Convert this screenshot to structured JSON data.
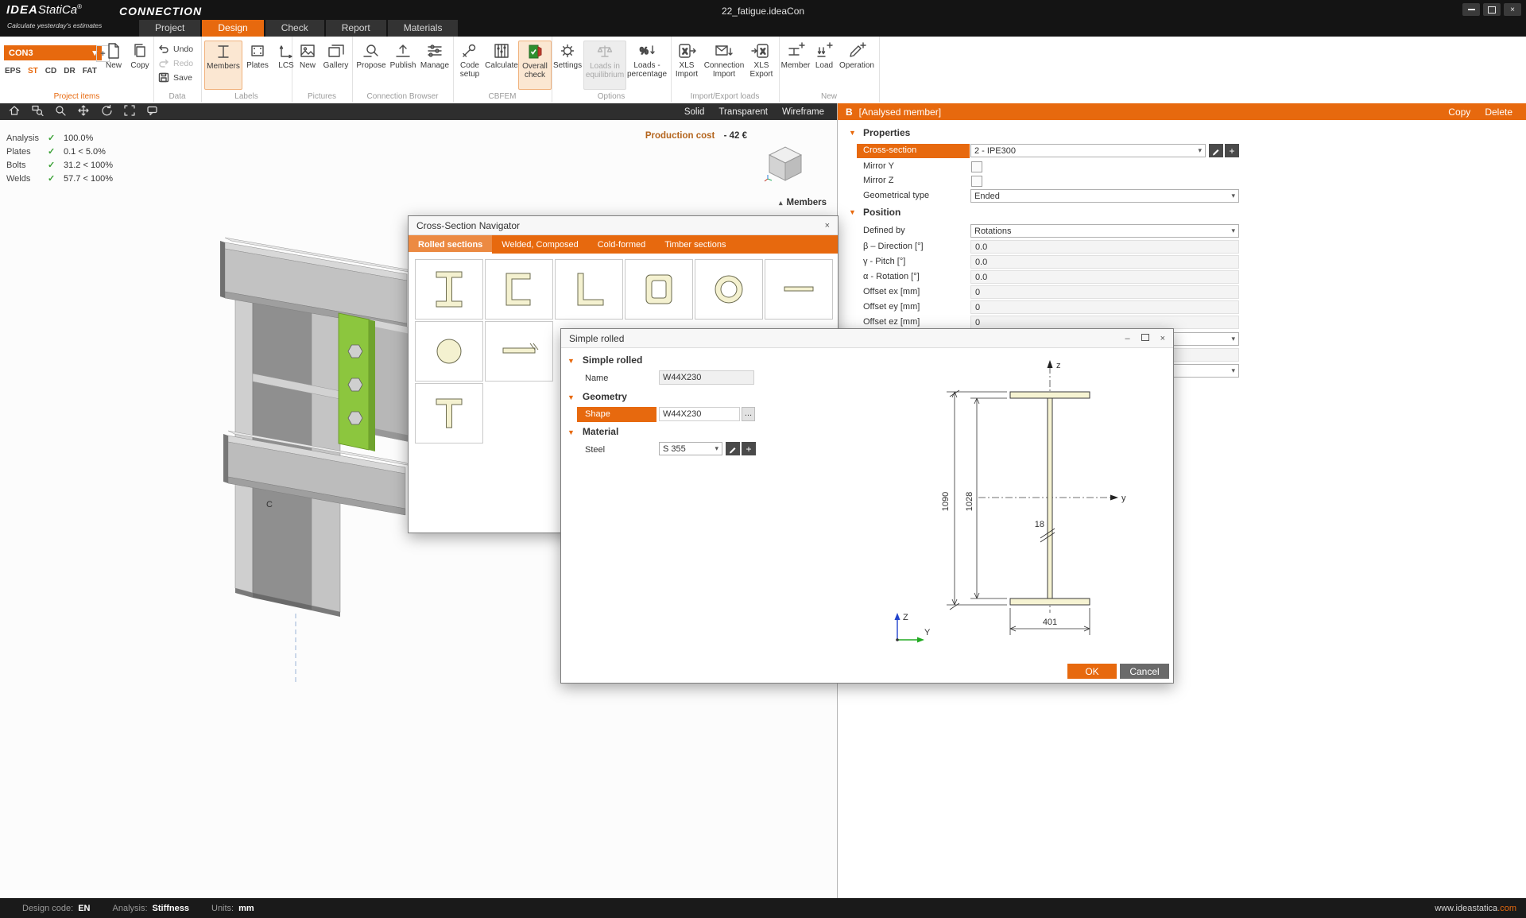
{
  "window": {
    "logo_idea": "IDEA",
    "logo_statica": "StatiCa",
    "logo_reg": "®",
    "app_name": "CONNECTION",
    "tagline": "Calculate yesterday's estimates",
    "doc_title": "22_fatigue.ideaCon"
  },
  "tabs": [
    {
      "label": "Project"
    },
    {
      "label": "Design"
    },
    {
      "label": "Check"
    },
    {
      "label": "Report"
    },
    {
      "label": "Materials"
    }
  ],
  "ribbon": {
    "project_items": {
      "caption": "Project items",
      "selector_value": "CON3",
      "modes": [
        "EPS",
        "ST",
        "CD",
        "DR",
        "FAT"
      ],
      "new_label": "New",
      "copy_label": "Copy"
    },
    "data": {
      "caption": "Data",
      "undo": "Undo",
      "redo": "Redo",
      "save": "Save"
    },
    "labels": {
      "caption": "Labels",
      "members": "Members",
      "plates": "Plates",
      "lcs": "LCS"
    },
    "pictures": {
      "caption": "Pictures",
      "new": "New",
      "gallery": "Gallery"
    },
    "browser": {
      "caption": "Connection Browser",
      "propose": "Propose",
      "publish": "Publish",
      "manage": "Manage"
    },
    "cbfem": {
      "caption": "CBFEM",
      "code_setup": "Code setup",
      "calculate": "Calculate",
      "overall_check": "Overall check"
    },
    "options": {
      "caption": "Options",
      "settings": "Settings",
      "loads_eq": "Loads in equilibrium",
      "loads_pct": "Loads - percentage"
    },
    "impexp": {
      "caption": "Import/Export loads",
      "xls_import": "XLS Import",
      "conn_import": "Connection Import",
      "xls_export": "XLS Export"
    },
    "new_group": {
      "caption": "New",
      "member": "Member",
      "load": "Load",
      "operation": "Operation"
    }
  },
  "view_modes": {
    "solid": "Solid",
    "transparent": "Transparent",
    "wireframe": "Wireframe"
  },
  "results": {
    "rows": [
      {
        "label": "Analysis",
        "value": "100.0%"
      },
      {
        "label": "Plates",
        "value": "0.1 < 5.0%"
      },
      {
        "label": "Bolts",
        "value": "31.2 < 100%"
      },
      {
        "label": "Welds",
        "value": "57.7 < 100%"
      }
    ]
  },
  "viewport": {
    "production_cost_label": "Production cost",
    "production_cost_value": "-  42 €",
    "members_label": "Members",
    "node_label": "C"
  },
  "panel": {
    "badge": "B",
    "title": "[Analysed member]",
    "copy": "Copy",
    "delete": "Delete",
    "properties_title": "Properties",
    "position_title": "Position",
    "rows": {
      "cross_section": {
        "label": "Cross-section",
        "value": "2 - IPE300"
      },
      "mirror_y": {
        "label": "Mirror Y"
      },
      "mirror_z": {
        "label": "Mirror Z"
      },
      "geom_type": {
        "label": "Geometrical type",
        "value": "Ended"
      },
      "defined_by": {
        "label": "Defined by",
        "value": "Rotations"
      },
      "beta": {
        "label": "β – Direction [°]",
        "value": "0.0"
      },
      "gamma": {
        "label": "γ - Pitch [°]",
        "value": "0.0"
      },
      "alpha": {
        "label": "α - Rotation [°]",
        "value": "0.0"
      },
      "offset_ex": {
        "label": "Offset ex [mm]",
        "value": "0"
      },
      "offset_ey": {
        "label": "Offset ey [mm]",
        "value": "0"
      },
      "offset_ez": {
        "label": "Offset ez [mm]",
        "value": "0"
      }
    }
  },
  "navigator": {
    "title": "Cross-Section Navigator",
    "tabs": [
      "Rolled sections",
      "Welded, Composed",
      "Cold-formed",
      "Timber sections"
    ]
  },
  "shape_dialog": {
    "title": "Simple rolled",
    "section_simple": "Simple rolled",
    "name_label": "Name",
    "name_value": "W44X230",
    "section_geometry": "Geometry",
    "shape_label": "Shape",
    "shape_value": "W44X230",
    "browse_label": "...",
    "section_material": "Material",
    "steel_label": "Steel",
    "steel_value": "S 355",
    "ok": "OK",
    "cancel": "Cancel",
    "drawing": {
      "height_total": "1090",
      "height_inner": "1028",
      "web_thickness": "18",
      "flange_width": "401",
      "axis_z": "z",
      "axis_y": "y",
      "triad_z": "Z",
      "triad_y": "Y"
    }
  },
  "statusbar": {
    "design_code_label": "Design code:",
    "design_code_value": "EN",
    "analysis_label": "Analysis:",
    "analysis_value": "Stiffness",
    "units_label": "Units:",
    "units_value": "mm",
    "website_main": "www.ideastatica",
    "website_tld": ".com"
  }
}
